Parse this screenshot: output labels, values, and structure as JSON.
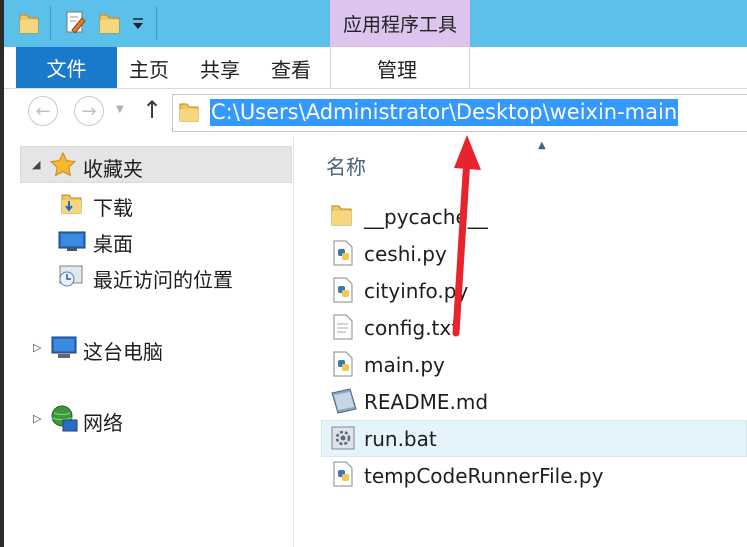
{
  "window": {
    "context_tab_title": "应用程序工具",
    "tabs": [
      {
        "label": "文件"
      },
      {
        "label": "主页"
      },
      {
        "label": "共享"
      },
      {
        "label": "查看"
      },
      {
        "label": "管理"
      }
    ]
  },
  "address_bar": {
    "path": "C:\\Users\\Administrator\\Desktop\\weixin-main"
  },
  "nav_pane": {
    "favorites": "收藏夹",
    "items": [
      {
        "label": "下载",
        "icon": "download-folder-icon"
      },
      {
        "label": "桌面",
        "icon": "desktop-icon"
      },
      {
        "label": "最近访问的位置",
        "icon": "recent-places-icon"
      }
    ],
    "this_pc": "这台电脑",
    "network": "网络"
  },
  "content": {
    "column_header": "名称",
    "files": [
      {
        "name": "__pycache__",
        "icon": "folder-icon"
      },
      {
        "name": "ceshi.py",
        "icon": "python-file-icon"
      },
      {
        "name": "cityinfo.py",
        "icon": "python-file-icon"
      },
      {
        "name": "config.txt",
        "icon": "text-file-icon"
      },
      {
        "name": "main.py",
        "icon": "python-file-icon"
      },
      {
        "name": "README.md",
        "icon": "markdown-file-icon"
      },
      {
        "name": "run.bat",
        "icon": "batch-file-icon",
        "selected": true
      },
      {
        "name": "tempCodeRunnerFile.py",
        "icon": "python-file-icon"
      }
    ]
  },
  "colors": {
    "titlebar": "#5bc0ea",
    "file_tab": "#1979ca",
    "context_tab": "#dcc4ef",
    "address_highlight": "#3399ff",
    "annotation_arrow": "#e8232b"
  }
}
